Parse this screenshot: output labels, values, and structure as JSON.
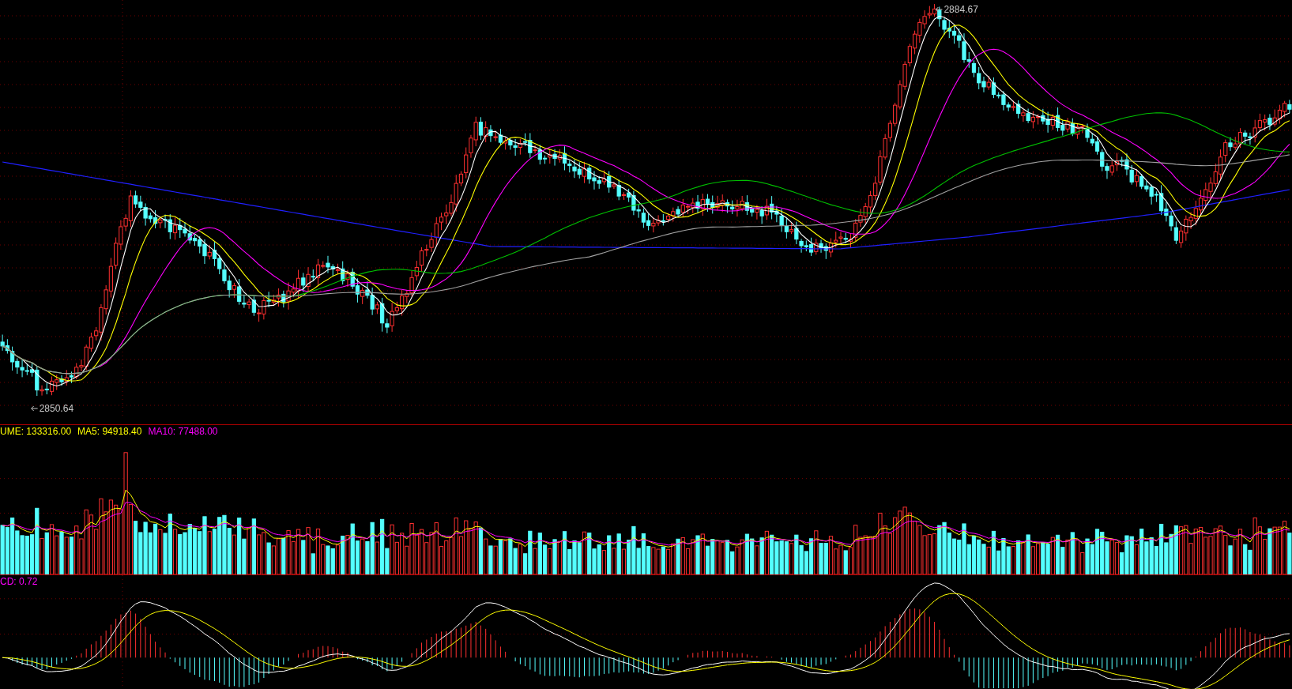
{
  "price_panel": {
    "high_label": "2884.67",
    "low_label": "2850.64"
  },
  "volume_panel": {
    "legend": [
      {
        "text": "UME: 133316.00",
        "color": "#ffff00"
      },
      {
        "text": "MA5: 94918.40",
        "color": "#ffff00"
      },
      {
        "text": "MA10: 77488.00",
        "color": "#ff00ff"
      }
    ]
  },
  "macd_panel": {
    "legend": {
      "text": "CD: 0.72",
      "color": "#ff00ff"
    }
  }
}
